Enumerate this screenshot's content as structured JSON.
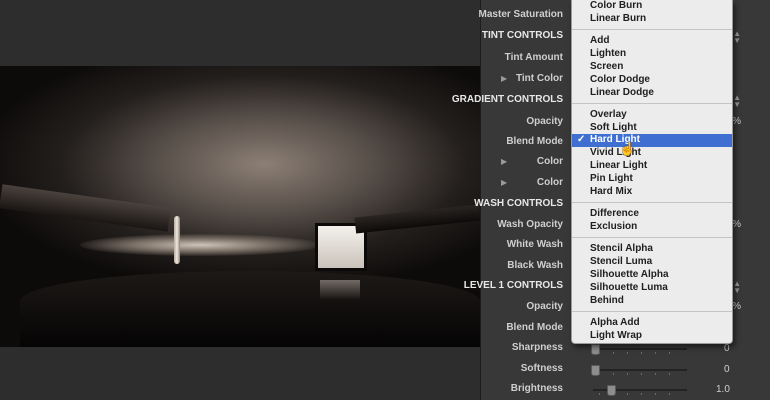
{
  "inspector": {
    "master_saturation": "Master Saturation",
    "tint_controls": "TINT CONTROLS",
    "tint_amount": "Tint Amount",
    "tint_color": "Tint Color",
    "gradient_controls": "GRADIENT CONTROLS",
    "gradient_opacity": "Opacity",
    "gradient_blend": "Blend Mode",
    "color1": "Color",
    "color2": "Color",
    "wash_controls": "WASH CONTROLS",
    "wash_opacity": "Wash Opacity",
    "white_wash": "White Wash",
    "black_wash": "Black Wash",
    "level1_controls": "LEVEL 1 CONTROLS",
    "level1_opacity": "Opacity",
    "level1_blend": "Blend Mode",
    "pct_suffix": "%",
    "sharpness_label": "Sharpness",
    "sharpness_value": "0",
    "softness_label": "Softness",
    "softness_value": "0",
    "brightness_label": "Brightness",
    "brightness_value": "1.0"
  },
  "blend_menu": {
    "group1": [
      "Color Burn",
      "Linear Burn"
    ],
    "group2": [
      "Add",
      "Lighten",
      "Screen",
      "Color Dodge",
      "Linear Dodge"
    ],
    "group3": [
      "Overlay",
      "Soft Light",
      "Hard Light",
      "Vivid Light",
      "Linear Light",
      "Pin Light",
      "Hard Mix"
    ],
    "group4": [
      "Difference",
      "Exclusion"
    ],
    "group5": [
      "Stencil Alpha",
      "Stencil Luma",
      "Silhouette Alpha",
      "Silhouette Luma",
      "Behind"
    ],
    "group6": [
      "Alpha Add",
      "Light Wrap"
    ],
    "selected": "Hard Light",
    "check_glyph": "✓"
  },
  "colors": {
    "selection": "#3f6fd0",
    "inspector_bg": "#383838",
    "menu_bg": "#ececec"
  }
}
